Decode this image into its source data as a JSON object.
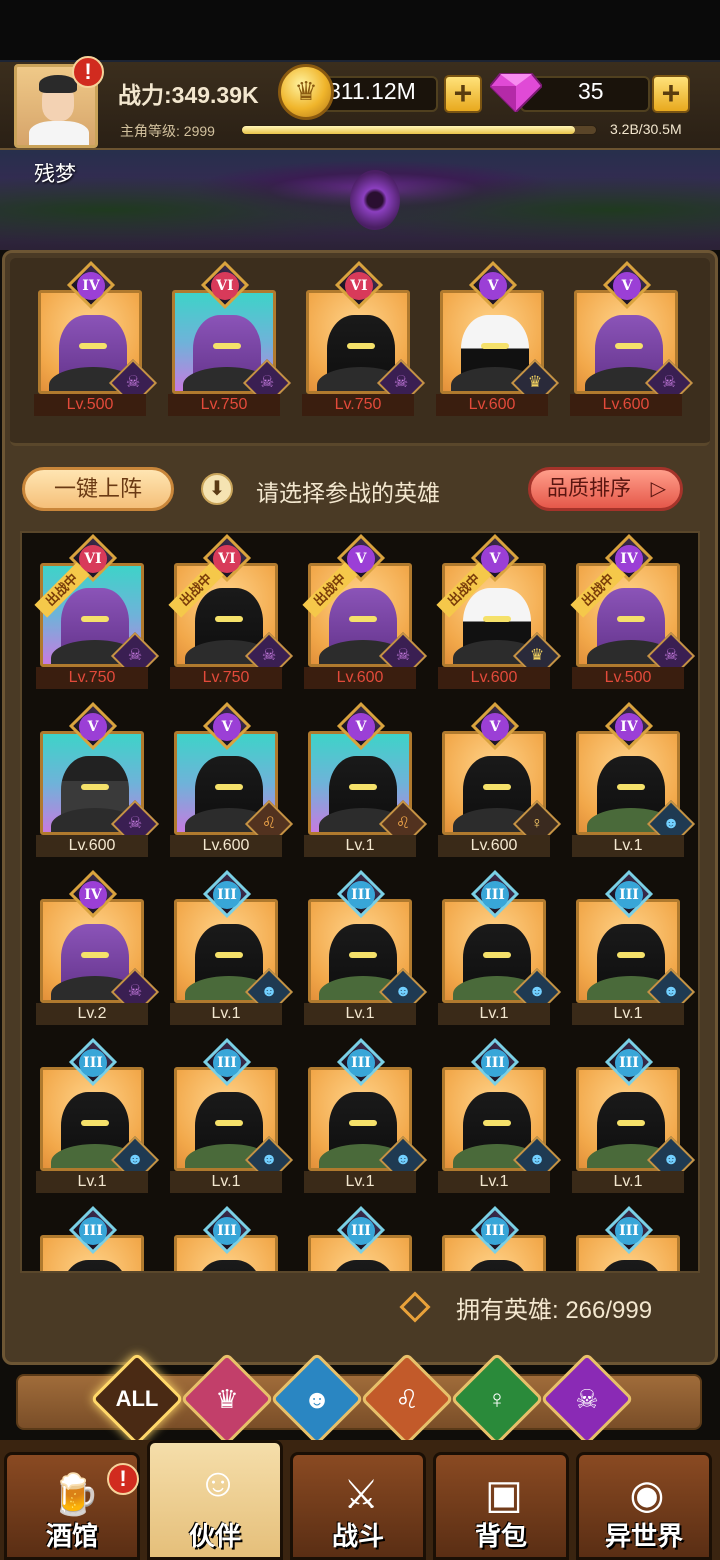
{
  "player": {
    "name": "残梦",
    "power": "战力:349.39K",
    "level_label": "主角等级:",
    "level": "2999",
    "xp_text": "3.2B/30.5M",
    "xp_fraction": 0.94,
    "avatar_alert": "!"
  },
  "resources": {
    "gold": "311.12M",
    "gems": "35",
    "plus": "+"
  },
  "team": [
    {
      "rank": "IV",
      "tier": "iv",
      "bg": "gold",
      "figure": "purple",
      "class": "demon",
      "level": "Lv.500"
    },
    {
      "rank": "VI",
      "tier": "vi",
      "bg": "cyan",
      "figure": "purple",
      "class": "demon",
      "level": "Lv.750"
    },
    {
      "rank": "VI",
      "tier": "vi",
      "bg": "gold",
      "figure": "black",
      "class": "demon",
      "level": "Lv.750"
    },
    {
      "rank": "V",
      "tier": "v",
      "bg": "gold",
      "figure": "white",
      "class": "king",
      "level": "Lv.600"
    },
    {
      "rank": "V",
      "tier": "v",
      "bg": "gold",
      "figure": "purple",
      "class": "demon",
      "level": "Lv.600"
    }
  ],
  "actions": {
    "one_click": "一键上阵",
    "hint": "请选择参战的英雄",
    "sort": "品质排序",
    "sort_arrow": "▷",
    "hint_icon": "⬇"
  },
  "in_battle_label": "出战中",
  "heroes": [
    {
      "rank": "VI",
      "tier": "vi",
      "bg": "cyan",
      "figure": "purple",
      "class": "demon",
      "level": "Lv.750",
      "in_battle": true
    },
    {
      "rank": "VI",
      "tier": "vi",
      "bg": "gold",
      "figure": "black",
      "class": "demon",
      "level": "Lv.750",
      "in_battle": true
    },
    {
      "rank": "V",
      "tier": "v",
      "bg": "gold",
      "figure": "purple",
      "class": "demon",
      "level": "Lv.600",
      "in_battle": true
    },
    {
      "rank": "V",
      "tier": "v",
      "bg": "gold",
      "figure": "white",
      "class": "king",
      "level": "Lv.600",
      "in_battle": true
    },
    {
      "rank": "IV",
      "tier": "iv",
      "bg": "gold",
      "figure": "purple",
      "class": "demon",
      "level": "Lv.500",
      "in_battle": true
    },
    {
      "rank": "V",
      "tier": "v",
      "bg": "cyan",
      "figure": "ghost",
      "class": "demon",
      "level": "Lv.600",
      "in_battle": false
    },
    {
      "rank": "V",
      "tier": "v",
      "bg": "cyan",
      "figure": "black",
      "class": "lion",
      "level": "Lv.600",
      "in_battle": false
    },
    {
      "rank": "V",
      "tier": "v",
      "bg": "cyan",
      "figure": "black",
      "class": "lion",
      "level": "Lv.1",
      "in_battle": false
    },
    {
      "rank": "V",
      "tier": "v",
      "bg": "gold",
      "figure": "black",
      "class": "goddess",
      "level": "Lv.600",
      "in_battle": false
    },
    {
      "rank": "IV",
      "tier": "iv",
      "bg": "gold",
      "figure": "black",
      "class": "elf",
      "level": "Lv.1",
      "in_battle": false
    },
    {
      "rank": "IV",
      "tier": "iv",
      "bg": "gold",
      "figure": "purple",
      "class": "demon",
      "level": "Lv.2",
      "in_battle": false
    },
    {
      "rank": "III",
      "tier": "iii",
      "bg": "gold",
      "figure": "black",
      "class": "elf",
      "level": "Lv.1",
      "in_battle": false
    },
    {
      "rank": "III",
      "tier": "iii",
      "bg": "gold",
      "figure": "black",
      "class": "elf",
      "level": "Lv.1",
      "in_battle": false
    },
    {
      "rank": "III",
      "tier": "iii",
      "bg": "gold",
      "figure": "black",
      "class": "elf",
      "level": "Lv.1",
      "in_battle": false
    },
    {
      "rank": "III",
      "tier": "iii",
      "bg": "gold",
      "figure": "black",
      "class": "elf",
      "level": "Lv.1",
      "in_battle": false
    },
    {
      "rank": "III",
      "tier": "iii",
      "bg": "gold",
      "figure": "black",
      "class": "elf",
      "level": "Lv.1",
      "in_battle": false
    },
    {
      "rank": "III",
      "tier": "iii",
      "bg": "gold",
      "figure": "black",
      "class": "elf",
      "level": "Lv.1",
      "in_battle": false
    },
    {
      "rank": "III",
      "tier": "iii",
      "bg": "gold",
      "figure": "black",
      "class": "elf",
      "level": "Lv.1",
      "in_battle": false
    },
    {
      "rank": "III",
      "tier": "iii",
      "bg": "gold",
      "figure": "black",
      "class": "elf",
      "level": "Lv.1",
      "in_battle": false
    },
    {
      "rank": "III",
      "tier": "iii",
      "bg": "gold",
      "figure": "black",
      "class": "elf",
      "level": "Lv.1",
      "in_battle": false
    },
    {
      "rank": "III",
      "tier": "iii",
      "bg": "gold",
      "figure": "black",
      "class": "elf",
      "level": "",
      "in_battle": false
    },
    {
      "rank": "III",
      "tier": "iii",
      "bg": "gold",
      "figure": "black",
      "class": "elf",
      "level": "",
      "in_battle": false
    },
    {
      "rank": "III",
      "tier": "iii",
      "bg": "gold",
      "figure": "black",
      "class": "elf",
      "level": "",
      "in_battle": false
    },
    {
      "rank": "III",
      "tier": "iii",
      "bg": "gold",
      "figure": "black",
      "class": "elf",
      "level": "",
      "in_battle": false
    },
    {
      "rank": "III",
      "tier": "iii",
      "bg": "gold",
      "figure": "black",
      "class": "elf",
      "level": "",
      "in_battle": false
    }
  ],
  "owned": "拥有英雄: 266/999",
  "filters": [
    {
      "id": "all",
      "label": "ALL"
    },
    {
      "id": "king",
      "label": "♛"
    },
    {
      "id": "elf",
      "label": "☻"
    },
    {
      "id": "lion",
      "label": "♌"
    },
    {
      "id": "goddess",
      "label": "♀"
    },
    {
      "id": "demon",
      "label": "☠"
    }
  ],
  "nav": [
    {
      "id": "tavern",
      "label": "酒馆",
      "icon": "🍺",
      "alert": "!"
    },
    {
      "id": "partner",
      "label": "伙伴",
      "icon": "☺"
    },
    {
      "id": "battle",
      "label": "战斗",
      "icon": "⚔"
    },
    {
      "id": "bag",
      "label": "背包",
      "icon": "▣"
    },
    {
      "id": "otherworld",
      "label": "异世界",
      "icon": "◉"
    }
  ]
}
